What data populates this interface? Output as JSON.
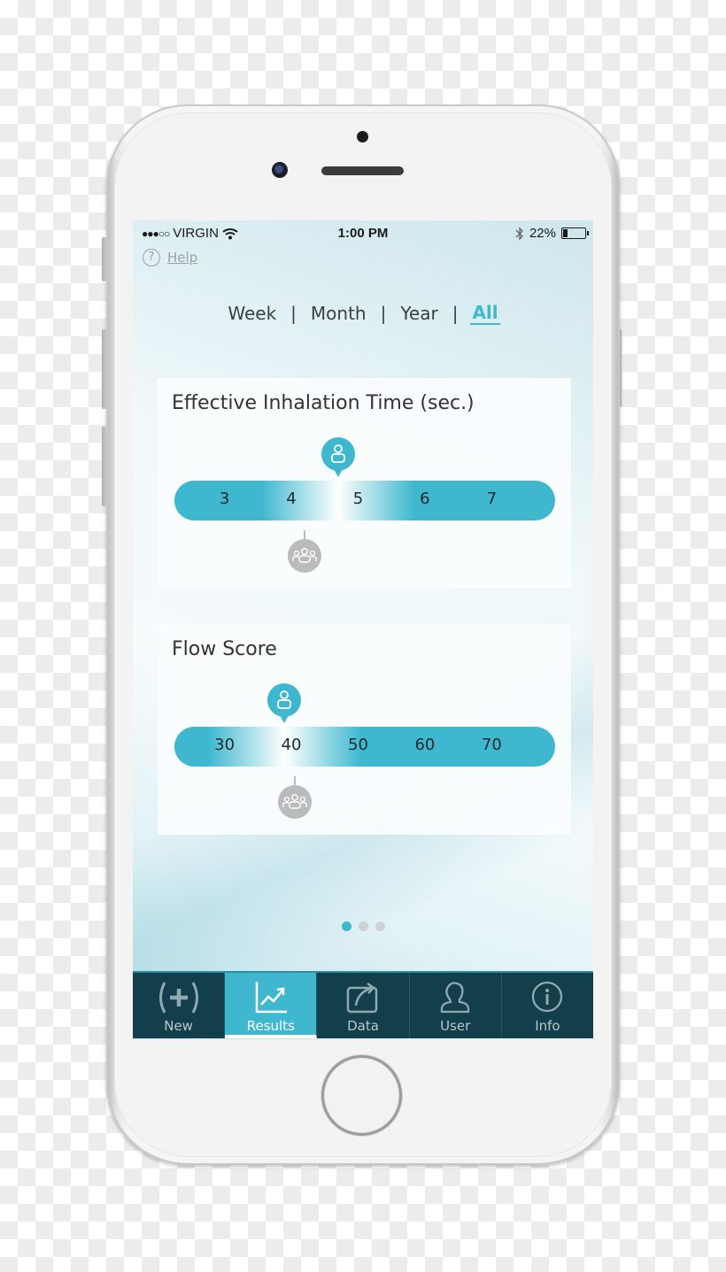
{
  "status_bar": {
    "signal": "●●●○○",
    "carrier": "VIRGIN",
    "time": "1:00 PM",
    "battery_percent": "22%",
    "battery_level": 0.22
  },
  "help": {
    "icon": "?",
    "label": "Help"
  },
  "range_tabs": [
    {
      "label": "Week",
      "active": false
    },
    {
      "label": "Month",
      "active": false
    },
    {
      "label": "Year",
      "active": false
    },
    {
      "label": "All",
      "active": true
    }
  ],
  "range_separator": "|",
  "colors": {
    "accent": "#3fb8cf",
    "tabbar_bg": "#123f4b",
    "group_marker": "#b9bbbc"
  },
  "cards": [
    {
      "title": "Effective Inhalation Time (sec.)",
      "ticks": [
        "3",
        "4",
        "5",
        "6",
        "7"
      ],
      "scale_min": 2.25,
      "scale_max": 7.95,
      "highlight_value": 4.7,
      "user_value": 4.7,
      "group_value": 4.2
    },
    {
      "title": "Flow Score",
      "ticks": [
        "30",
        "40",
        "50",
        "60",
        "70"
      ],
      "scale_min": 22.5,
      "scale_max": 79.5,
      "highlight_value": 39,
      "user_value": 39,
      "group_value": 40.5
    }
  ],
  "pager": {
    "pages": 3,
    "current": 1
  },
  "tab_bar": [
    {
      "label": "New",
      "icon": "add-icon",
      "active": false
    },
    {
      "label": "Results",
      "icon": "chart-icon",
      "active": true
    },
    {
      "label": "Data",
      "icon": "share-icon",
      "active": false
    },
    {
      "label": "User",
      "icon": "user-icon",
      "active": false
    },
    {
      "label": "Info",
      "icon": "info-icon",
      "active": false
    }
  ]
}
